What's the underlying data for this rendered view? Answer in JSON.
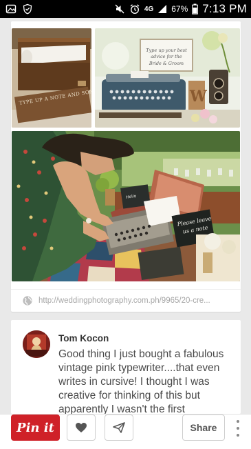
{
  "status_bar": {
    "network": "4G",
    "battery": "67%",
    "time": "7:13 PM"
  },
  "pin": {
    "source_url": "http://weddingphotography.com.ph/9965/20-cre...",
    "images": {
      "sign_text": "Type up your best advice for the Bride & Groom",
      "chalk_text": "Please leave us a note",
      "crate_text": "TYPE UP A NOTE AND SOME TIME"
    }
  },
  "comment": {
    "author": "Tom Kocon",
    "text": "Good thing I just bought a fabulous vintage pink typewriter....that even writes in cursive! I thought I was creative for thinking of this but apparently I wasn't the first"
  },
  "actions": {
    "pin_it": "Pin it",
    "share": "Share"
  },
  "colors": {
    "pinterest_red": "#cf2128",
    "background": "#e9e9e9"
  }
}
